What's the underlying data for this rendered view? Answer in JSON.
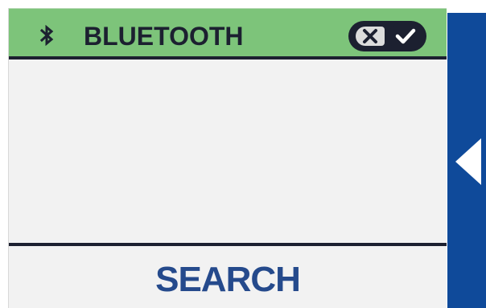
{
  "header": {
    "title": "BLUETOOTH",
    "icon": "bluetooth-icon",
    "toggle": {
      "state": "on",
      "off_icon": "x-icon",
      "on_icon": "checkmark-icon"
    }
  },
  "content": {
    "items": []
  },
  "footer": {
    "search_label": "SEARCH"
  },
  "side_panel": {
    "icon": "triangle-left-icon"
  },
  "colors": {
    "header_bg": "#7dc47a",
    "dark": "#1c2030",
    "panel_bg": "#f2f2f2",
    "search_text": "#254a8c",
    "side_tab": "#0f4a9a"
  }
}
